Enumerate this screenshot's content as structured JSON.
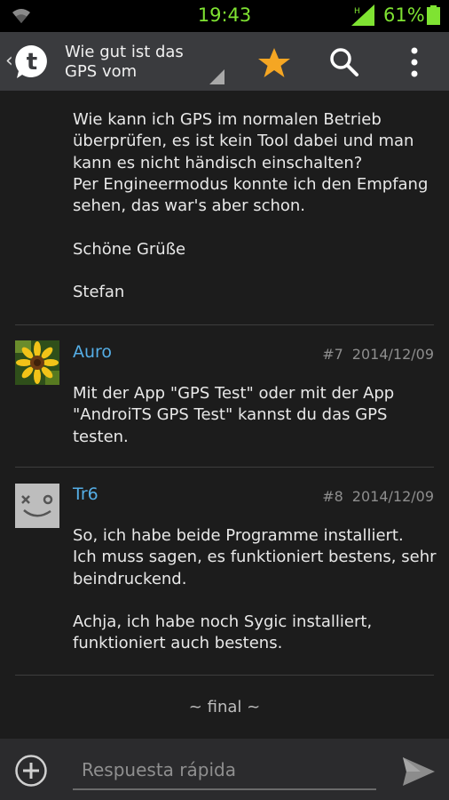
{
  "status_bar": {
    "time": "19:43",
    "battery": "61%"
  },
  "header": {
    "title": "Wie gut ist das GPS vom"
  },
  "posts": [
    {
      "body": "Wie kann ich GPS im normalen Betrieb\nüberprüfen, es ist kein Tool dabei und man\nkann es nicht händisch einschalten?\nPer Engineermodus konnte ich den Empfang\nsehen, das war's aber schon.\n\nSchöne Grüße\n\nStefan"
    },
    {
      "author": "Auro",
      "number": "#7",
      "date": "2014/12/09",
      "body": "Mit der App \"GPS Test\" oder mit der App\n\"AndroiTS GPS Test\" kannst du das GPS\ntesten."
    },
    {
      "author": "Tr6",
      "number": "#8",
      "date": "2014/12/09",
      "body": "So, ich habe beide Programme installiert.\nIch muss sagen, es funktioniert bestens, sehr\nbeindruckend.\n\nAchja, ich habe noch Sygic installiert,\nfunktioniert auch bestens."
    }
  ],
  "footer": {
    "end_marker": "~ final ~"
  },
  "reply": {
    "placeholder": "Respuesta rápida"
  },
  "colors": {
    "accent": "#55aee6",
    "status_green": "#7fe332",
    "star": "#f5a623"
  }
}
